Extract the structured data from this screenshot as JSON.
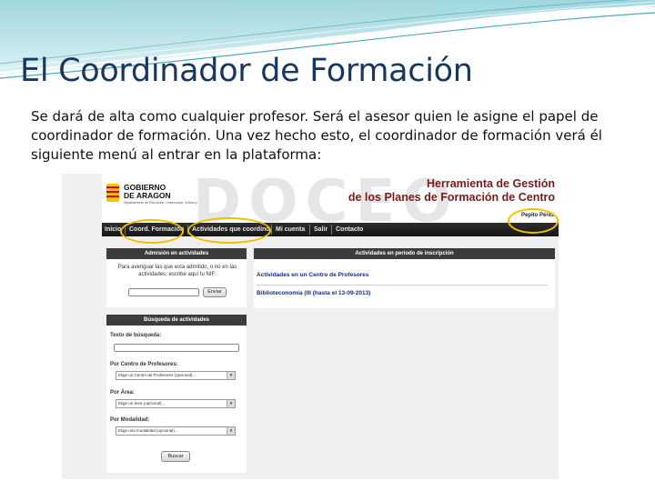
{
  "slide": {
    "title": "El Coordinador de Formación",
    "body": "Se dará de alta como cualquier profesor. Será el asesor quien le asigne el papel de coordinador de formación. Una vez hecho esto, el coordinador de formación verá él siguiente menú al entrar en la plataforma:"
  },
  "app": {
    "logo_line1": "GOBIERNO",
    "logo_line2": "DE ARAGON",
    "logo_sub": "Departamento de Educación, Universidad, Cultura y Deporte",
    "watermark": "DOCEO",
    "tool_title_1": "Herramienta de Gestión",
    "tool_title_2": "de los Planes de Formación de Centro",
    "user_name": "Pepito Pérez",
    "menu": [
      "Inicio",
      "Coord. Formación",
      "Actividades que coordino",
      "Mi cuenta",
      "Salir",
      "Contacto"
    ],
    "admission": {
      "header": "Admisión en actividades",
      "instructions": "Para averiguar las que está admitido, o no en las actividades, escribe aquí tu NIF:",
      "button": "Enviar"
    },
    "enrollment": {
      "header": "Actividades en periodo de inscripción",
      "cfp_link": "Actividades en un Centro de Profesores",
      "item": "Biblioteconomía (III (hasta el 13-09-2013)"
    },
    "search": {
      "header": "Búsqueda de actividades",
      "text_label": "Texto de búsqueda:",
      "cfp_label": "Por Centro de Profesores:",
      "cfp_value": "Elige un Centro de Profesores (opcional)...",
      "area_label": "Por Área:",
      "area_value": "Elige un área (opcional)...",
      "mode_label": "Por Modalidad:",
      "mode_value": "Elige una modalidad (opcional)...",
      "button": "Buscar"
    }
  },
  "colors": {
    "title": "#17375e",
    "tool_title": "#7a1a1a",
    "menubar": "#1e1e1e",
    "panel_header": "#3c3c3c",
    "highlight": "#f0c000",
    "link": "#1a2a88"
  }
}
